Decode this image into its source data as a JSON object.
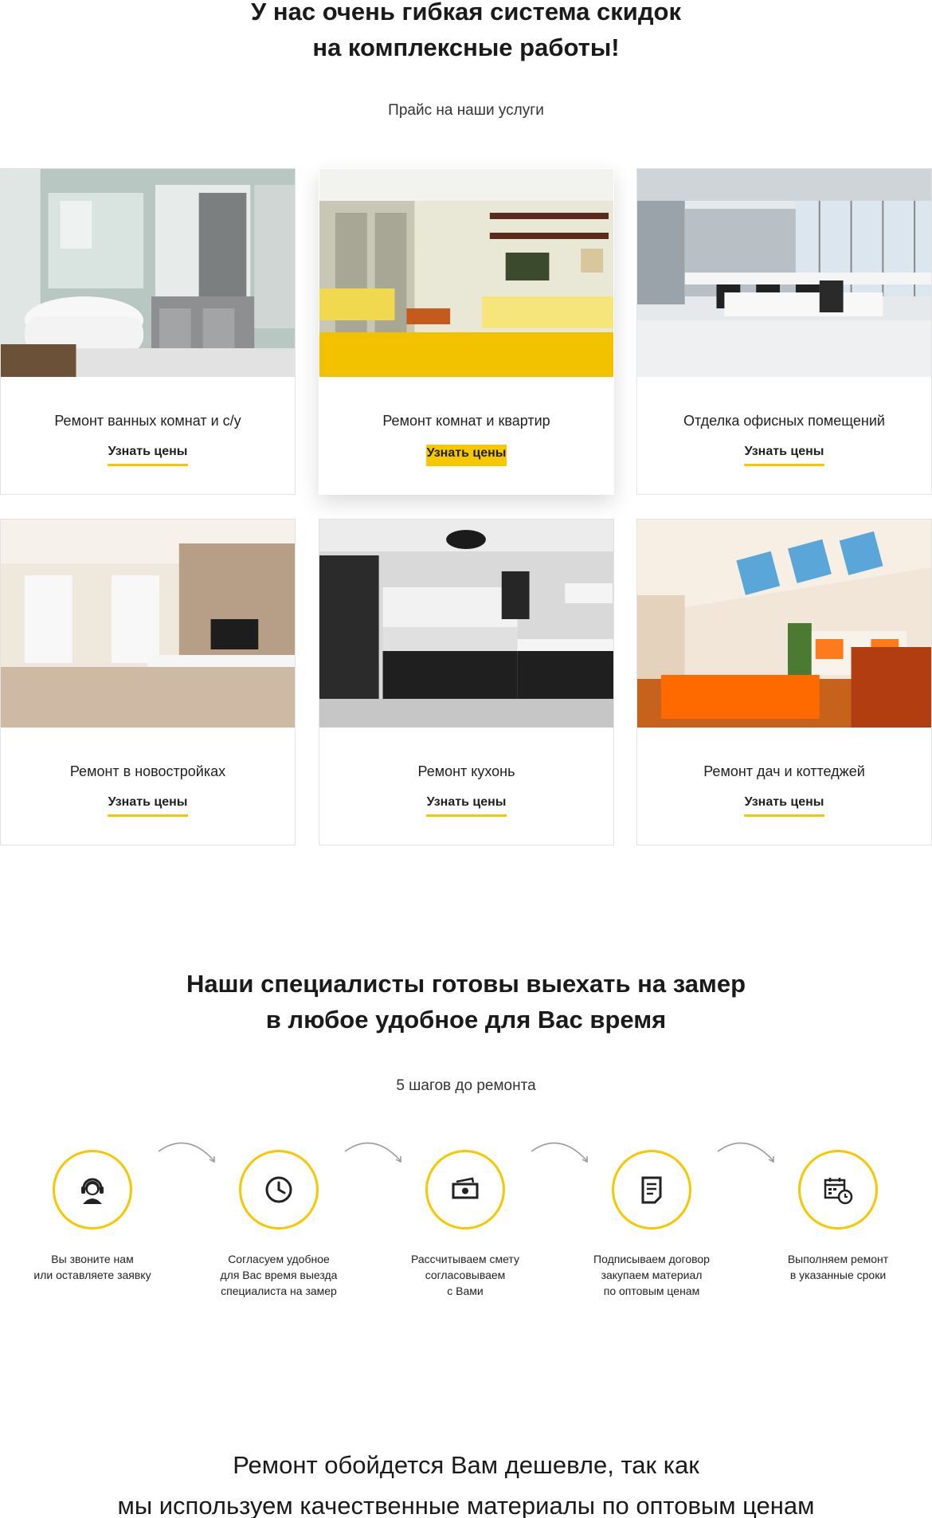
{
  "discount_section": {
    "title_line1": "У нас очень гибкая система скидок",
    "title_line2": "на комплексные работы!",
    "subtitle": "Прайс на наши услуги"
  },
  "services": [
    {
      "title": "Ремонт ванных комнат и с/у",
      "link": "Узнать цены",
      "image": "bathroom-photo"
    },
    {
      "title": "Ремонт комнат и квартир",
      "link": "Узнать цены",
      "image": "living-room-photo",
      "active": true
    },
    {
      "title": "Отделка офисных помещений",
      "link": "Узнать цены",
      "image": "office-photo"
    },
    {
      "title": "Ремонт в новостройках",
      "link": "Узнать цены",
      "image": "new-building-photo"
    },
    {
      "title": "Ремонт кухонь",
      "link": "Узнать цены",
      "image": "kitchen-photo"
    },
    {
      "title": "Ремонт дач и коттеджей",
      "link": "Узнать цены",
      "image": "cottage-photo"
    }
  ],
  "steps_section": {
    "title_line1": "Наши специалисты готовы выехать на замер",
    "title_line2": "в любое удобное для Вас время",
    "subtitle": "5 шагов до ремонта",
    "steps": [
      {
        "icon": "operator-headset-icon",
        "lines": [
          "Вы звоните нам",
          "или оставляете заявку"
        ]
      },
      {
        "icon": "clock-icon",
        "lines": [
          "Согласуем удобное",
          "для Вас время выезда",
          "специалиста на замер"
        ]
      },
      {
        "icon": "money-icon",
        "lines": [
          "Рассчитываем смету",
          "согласовываем",
          "с Вами"
        ]
      },
      {
        "icon": "document-icon",
        "lines": [
          "Подписываем договор",
          "закупаем материал",
          "по оптовым ценам"
        ]
      },
      {
        "icon": "calendar-clock-icon",
        "lines": [
          "Выполняем ремонт",
          "в указанные сроки"
        ]
      }
    ]
  },
  "bottom": {
    "line1": "Ремонт обойдется Вам дешевле, так как",
    "line2": "мы используем качественные материалы по оптовым ценам"
  },
  "colors": {
    "accent": "#f5c800",
    "text": "#1a1a1a",
    "border": "#e3e3e3"
  }
}
